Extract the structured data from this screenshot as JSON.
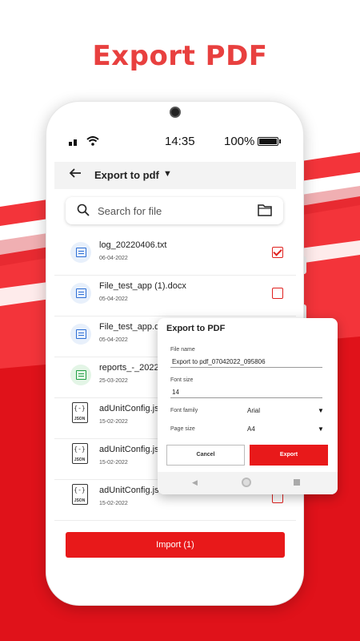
{
  "promo": {
    "title": "Export PDF"
  },
  "colors": {
    "accent": "#e8191a",
    "title": "#e8403f"
  },
  "status_bar": {
    "time": "14:35",
    "battery": "100%"
  },
  "app_bar": {
    "title": "Export to pdf"
  },
  "search": {
    "placeholder": "Search for file"
  },
  "files": [
    {
      "name": "log_20220406.txt",
      "date": "06-04-2022",
      "type": "doc",
      "checked": true
    },
    {
      "name": "File_test_app (1).docx",
      "date": "05-04-2022",
      "type": "doc",
      "checked": false
    },
    {
      "name": "File_test_app.docx",
      "date": "05-04-2022",
      "type": "doc",
      "checked": false
    },
    {
      "name": "reports_-_2022-",
      "date": "25-03-2022",
      "type": "xls",
      "checked": false
    },
    {
      "name": "adUnitConfig.json",
      "date": "15-02-2022",
      "type": "json",
      "checked": false
    },
    {
      "name": "adUnitConfig.json",
      "date": "15-02-2022",
      "type": "json",
      "checked": false
    },
    {
      "name": "adUnitConfig.json",
      "date": "15-02-2022",
      "type": "json",
      "checked": false
    }
  ],
  "json_icon": {
    "tag": "JSON",
    "braces": "{-}"
  },
  "import_button": {
    "label": "Import (1)"
  },
  "dialog": {
    "title": "Export to PDF",
    "file_name_label": "File name",
    "file_name_value": "Export to pdf_07042022_095806",
    "font_size_label": "Font size",
    "font_size_value": "14",
    "font_family_label": "Font family",
    "font_family_value": "Arial",
    "page_size_label": "Page size",
    "page_size_value": "A4",
    "cancel_label": "Cancel",
    "export_label": "Export"
  }
}
